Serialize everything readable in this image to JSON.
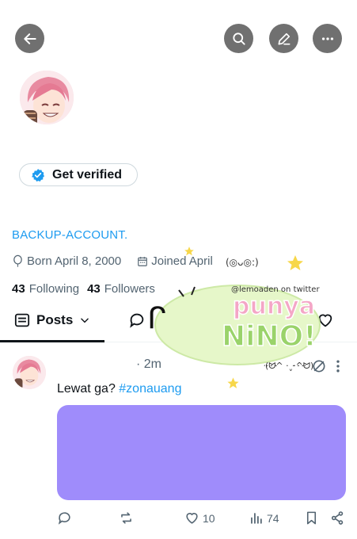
{
  "header": {
    "back_icon": "arrow-left-icon",
    "search_icon": "search-icon",
    "edit_icon": "pencil-icon",
    "more_icon": "ellipsis-icon"
  },
  "profile": {
    "verify_button_label": "Get verified",
    "handle": "BACKUP-ACCOUNT.",
    "born": "Born April 8, 2000",
    "joined": "Joined April",
    "following_count": "43",
    "following_label": "Following",
    "followers_count": "43",
    "followers_label": "Followers"
  },
  "tabs": {
    "active_label": "Posts"
  },
  "post": {
    "time": "· 2m",
    "text_prefix": "Lewat ga? ",
    "hashtag": "#zonauang",
    "media_color": "#9f8cfb",
    "reply_count": "",
    "repost_count": "",
    "like_count": "10",
    "view_count": "74"
  },
  "sticker": {
    "credit": "@lemoaden on twitter",
    "line1": "punya",
    "line2": "NiNO!",
    "face1": "(◎ᴗ◎:)",
    "face2": "(ᗢ^ ·ˬ·^ᗢ)"
  },
  "colors": {
    "accent": "#1d9bf0",
    "button_gray": "#707070",
    "media": "#9f8cfb"
  }
}
